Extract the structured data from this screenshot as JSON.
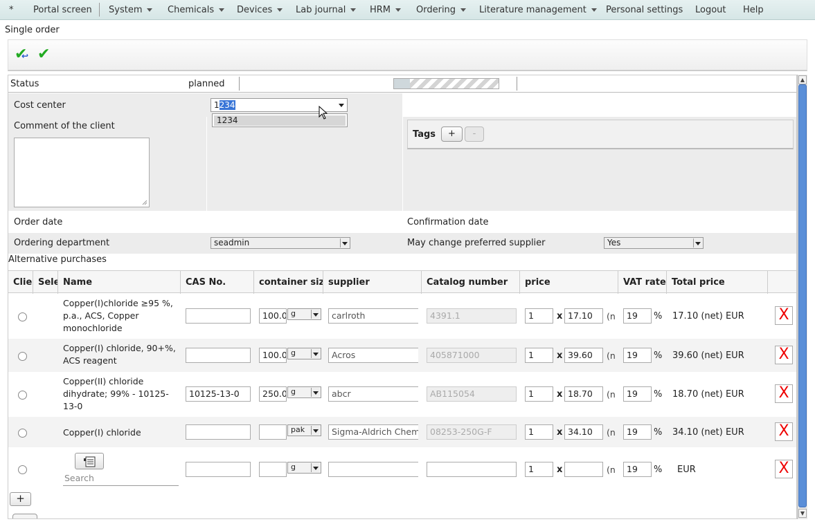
{
  "menu": {
    "items": [
      {
        "label": "*",
        "caret": false
      },
      {
        "label": "Portal screen",
        "caret": false
      },
      {
        "label": "System",
        "caret": true
      },
      {
        "label": "Chemicals",
        "caret": true
      },
      {
        "label": "Devices",
        "caret": true
      },
      {
        "label": "Lab journal",
        "caret": true
      },
      {
        "label": "HRM",
        "caret": true
      },
      {
        "label": "Ordering",
        "caret": true
      },
      {
        "label": "Literature management",
        "caret": true
      },
      {
        "label": "Personal settings",
        "caret": false
      },
      {
        "label": "Logout",
        "caret": false
      },
      {
        "label": "Help",
        "caret": false
      }
    ]
  },
  "page": {
    "title": "Single order"
  },
  "form": {
    "status_label": "Status",
    "status_value": "planned",
    "progress_fraction": 0.15,
    "cost_center_label": "Cost center",
    "cost_center_value_first": "1",
    "cost_center_value_selected": "234",
    "cost_center_option": "1234",
    "comment_label": "Comment of the client",
    "tags_label": "Tags",
    "tags_add": "+",
    "tags_remove": "-",
    "order_date_label": "Order date",
    "confirmation_date_label": "Confirmation date",
    "ordering_department_label": "Ordering department",
    "ordering_department_value": "seadmin",
    "may_change_label": "May change preferred supplier",
    "may_change_value": "Yes"
  },
  "alternatives": {
    "title": "Alternative purchases",
    "columns": [
      "Client",
      "Selected",
      "Name",
      "CAS No.",
      "container size",
      "supplier",
      "Catalog number",
      "price",
      "VAT rate",
      "Total price"
    ],
    "rows": [
      {
        "name": "Copper(I)chloride ≥95 %, p.a., ACS, Copper monochloride",
        "cas": "",
        "size": "100.0",
        "unit": "g",
        "supplier": "carlroth",
        "catalog": "4391.1",
        "qty": "1",
        "price": "17.10",
        "net": "(n",
        "vat": "19",
        "total": "17.10 (net) EUR"
      },
      {
        "name": "Copper(I) chloride, 90+%, ACS reagent",
        "cas": "",
        "size": "100.0",
        "unit": "g",
        "supplier": "Acros",
        "catalog": "405871000",
        "qty": "1",
        "price": "39.60",
        "net": "(n",
        "vat": "19",
        "total": "39.60 (net) EUR"
      },
      {
        "name": "Copper(II) chloride dihydrate; 99% - 10125-13-0",
        "cas": "10125-13-0",
        "size": "250.0",
        "unit": "g",
        "supplier": "abcr",
        "catalog": "AB115054",
        "qty": "1",
        "price": "18.70",
        "net": "(n",
        "vat": "19",
        "total": "18.70 (net) EUR"
      },
      {
        "name": "Copper(I) chloride",
        "cas": "",
        "size": "",
        "unit": "pak",
        "supplier": "Sigma-Aldrich Chemie",
        "catalog": "08253-250G-F",
        "qty": "1",
        "price": "34.10",
        "net": "(n",
        "vat": "19",
        "total": "34.10 (net) EUR"
      },
      {
        "name": "",
        "search_placeholder": "Search",
        "cas": "",
        "size": "",
        "unit": "g",
        "supplier": "",
        "catalog": "",
        "qty": "1",
        "price": "",
        "net": "(n",
        "vat": "19",
        "total": "EUR"
      }
    ],
    "x_symbol": "x",
    "percent_symbol": "%",
    "delete_symbol": "X",
    "add_row": "+"
  },
  "icons": {
    "toolbar": [
      "save-and-return-icon",
      "save-icon"
    ],
    "list": "list-icon"
  }
}
